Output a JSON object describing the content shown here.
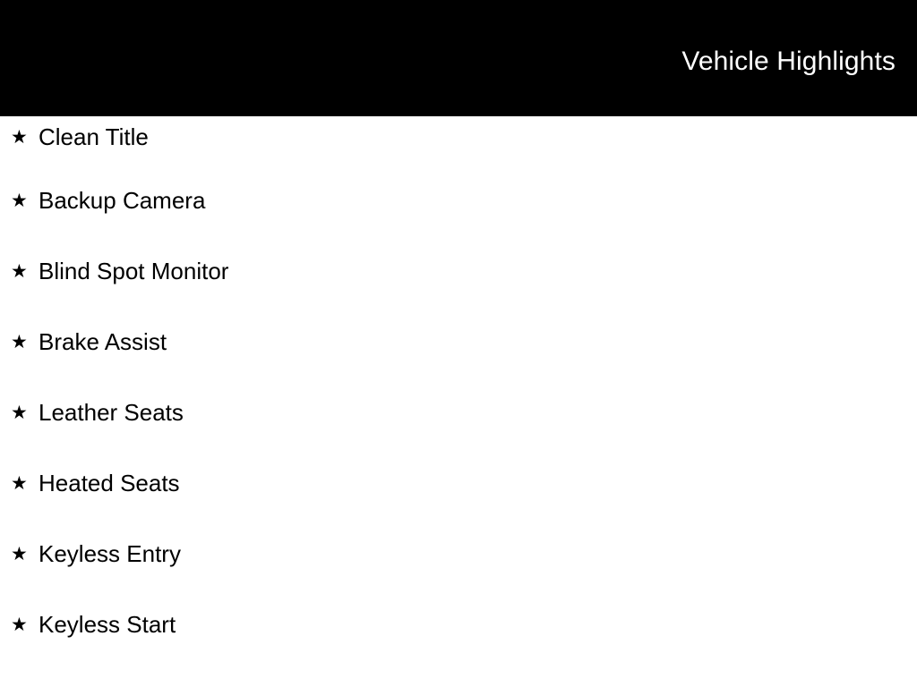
{
  "header": {
    "title": "Vehicle Highlights",
    "background_color": "#000000",
    "text_color": "#ffffff"
  },
  "page": {
    "background_color": "#ffffff",
    "text_color": "#000000"
  },
  "highlights": {
    "bullet_icon": "star-icon",
    "bullet_glyph": "★",
    "items": [
      {
        "label": "Clean Title"
      },
      {
        "label": "Backup Camera"
      },
      {
        "label": "Blind Spot Monitor"
      },
      {
        "label": "Brake Assist"
      },
      {
        "label": "Leather Seats"
      },
      {
        "label": "Heated Seats"
      },
      {
        "label": "Keyless Entry"
      },
      {
        "label": "Keyless Start"
      }
    ]
  }
}
